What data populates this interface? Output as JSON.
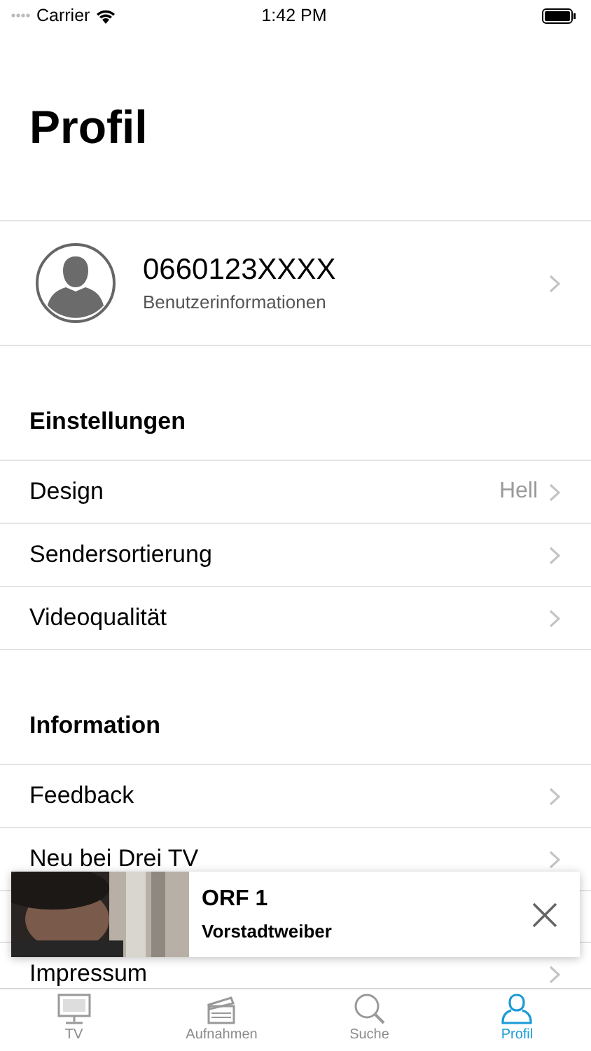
{
  "status_bar": {
    "carrier": "Carrier",
    "time": "1:42 PM"
  },
  "title": "Profil",
  "profile": {
    "name": "0660123XXXX",
    "subtitle": "Benutzerinformationen"
  },
  "sections": [
    {
      "title": "Einstellungen",
      "items": [
        {
          "label": "Design",
          "value": "Hell"
        },
        {
          "label": "Sendersortierung"
        },
        {
          "label": "Videoqualität"
        }
      ]
    },
    {
      "title": "Information",
      "items": [
        {
          "label": "Feedback"
        },
        {
          "label": "Neu bei Drei TV"
        },
        {
          "kind": "hidden"
        },
        {
          "label": "Impressum"
        }
      ]
    }
  ],
  "mini_player": {
    "channel": "ORF 1",
    "show": "Vorstadtweiber"
  },
  "tabs": [
    {
      "label": "TV",
      "selected": false
    },
    {
      "label": "Aufnahmen",
      "selected": false
    },
    {
      "label": "Suche",
      "selected": false
    },
    {
      "label": "Profil",
      "selected": true
    }
  ]
}
